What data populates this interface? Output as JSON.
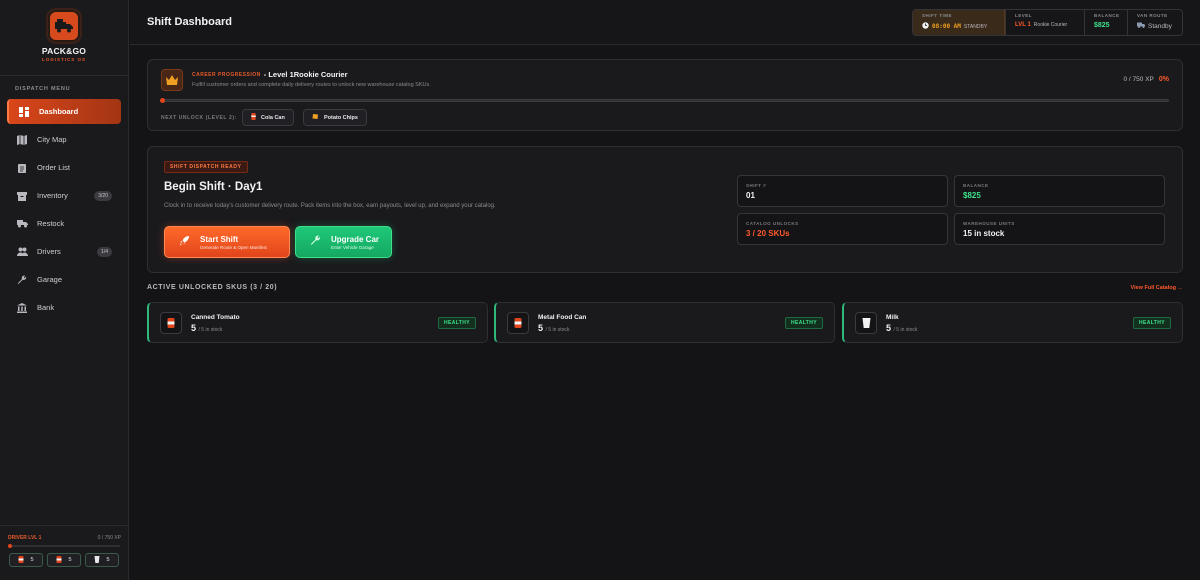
{
  "brand": {
    "name": "PACK&GO",
    "sub": "LOGISTICS OS"
  },
  "sidebar": {
    "menu_label": "DISPATCH MENU",
    "items": [
      {
        "label": "Dashboard",
        "icon": "dashboard-icon",
        "badge": ""
      },
      {
        "label": "City Map",
        "icon": "map-icon",
        "badge": ""
      },
      {
        "label": "Order List",
        "icon": "clipboard-icon",
        "badge": ""
      },
      {
        "label": "Inventory",
        "icon": "inventory-icon",
        "badge": "3/20"
      },
      {
        "label": "Restock",
        "icon": "truck-icon",
        "badge": ""
      },
      {
        "label": "Drivers",
        "icon": "users-icon",
        "badge": "1/4"
      },
      {
        "label": "Garage",
        "icon": "wrench-icon",
        "badge": ""
      },
      {
        "label": "Bank",
        "icon": "bank-icon",
        "badge": ""
      }
    ],
    "footer": {
      "driver_level": "DRIVER LVL 1",
      "xp": "0 / 750 XP",
      "mini": [
        "5",
        "5",
        "5"
      ]
    }
  },
  "header": {
    "title": "Shift Dashboard",
    "stats": {
      "shift_time_label": "SHIFT TIME",
      "shift_time": "08:00 AM",
      "shift_status": "STANDBY",
      "level_label": "LEVEL",
      "level": "LVL 1",
      "level_name": "Rookie Courier",
      "balance_label": "BALANCE",
      "balance": "$825",
      "van_label": "VAN ROUTE",
      "van_status": "Standby"
    }
  },
  "career": {
    "label": "CAREER PROGRESSION",
    "level": "- Level 1Rookie Courier",
    "desc": "Fulfill customer orders and complete daily delivery routes to unlock new warehouse catalog SKUs.",
    "xp": "0 / 750 XP",
    "pct": "0%",
    "progress": 0,
    "next_unlock_label": "NEXT UNLOCK (LEVEL 2):",
    "unlocks": [
      "Cola Can",
      "Potato Chips"
    ]
  },
  "shift": {
    "badge": "SHIFT DISPATCH READY",
    "title": "Begin Shift · Day1",
    "desc": "Clock in to receive today's customer delivery route. Pack items into the box, earn payouts, level up, and expand your catalog.",
    "start_label": "Start Shift",
    "start_sub": "Generate Route & Open Manifest",
    "upgrade_label": "Upgrade Car",
    "upgrade_sub": "Enter Vehicle Garage",
    "stats": {
      "shift_no_label": "SHIFT #",
      "shift_no": "01",
      "balance_label": "BALANCE",
      "balance": "$825",
      "catalog_label": "CATALOG UNLOCKS",
      "catalog": "3 / 20 SKUs",
      "warehouse_label": "WAREHOUSE UNITS",
      "warehouse": "15 in stock"
    }
  },
  "skus": {
    "heading": "ACTIVE UNLOCKED SKUS (3 / 20)",
    "view_link": "View Full Catalog →",
    "items": [
      {
        "name": "Canned Tomato",
        "count": "5",
        "of": "/ 5 in stock",
        "status": "HEALTHY",
        "icon": "can-icon"
      },
      {
        "name": "Metal Food Can",
        "count": "5",
        "of": "/ 5 in stock",
        "status": "HEALTHY",
        "icon": "can-icon"
      },
      {
        "name": "Milk",
        "count": "5",
        "of": "/ 5 in stock",
        "status": "HEALTHY",
        "icon": "milk-icon"
      }
    ]
  },
  "colors": {
    "accent": "#e0451b",
    "green": "#3ee08a",
    "bg": "#141417"
  }
}
